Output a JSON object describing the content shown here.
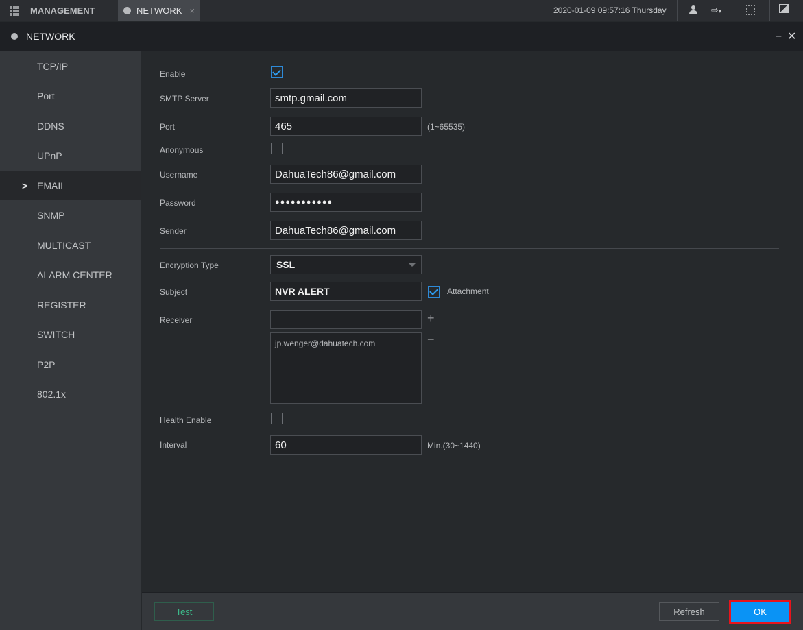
{
  "topbar": {
    "tabs": [
      {
        "label": "MANAGEMENT",
        "icon": "grid-icon"
      },
      {
        "label": "NETWORK",
        "icon": "globe-icon",
        "close": "×"
      }
    ],
    "datetime": "2020-01-09 09:57:16 Thursday"
  },
  "window": {
    "title": "NETWORK",
    "minimize": "–",
    "close": "✕"
  },
  "sidebar": {
    "items": [
      {
        "label": "TCP/IP"
      },
      {
        "label": "Port"
      },
      {
        "label": "DDNS"
      },
      {
        "label": "UPnP"
      },
      {
        "label": "EMAIL",
        "selected": true
      },
      {
        "label": "SNMP"
      },
      {
        "label": "MULTICAST"
      },
      {
        "label": "ALARM CENTER"
      },
      {
        "label": "REGISTER"
      },
      {
        "label": "SWITCH"
      },
      {
        "label": "P2P"
      },
      {
        "label": "802.1x"
      }
    ],
    "selected_marker": ">"
  },
  "form": {
    "enable": {
      "label": "Enable",
      "checked": true
    },
    "smtp_server": {
      "label": "SMTP Server",
      "value": "smtp.gmail.com"
    },
    "port": {
      "label": "Port",
      "value": "465",
      "hint": "(1~65535)"
    },
    "anonymous": {
      "label": "Anonymous",
      "checked": false
    },
    "username": {
      "label": "Username",
      "value": "DahuaTech86@gmail.com"
    },
    "password": {
      "label": "Password",
      "value": "●●●●●●●●●●●"
    },
    "sender": {
      "label": "Sender",
      "value": "DahuaTech86@gmail.com"
    },
    "encryption": {
      "label": "Encryption Type",
      "value": "SSL"
    },
    "subject": {
      "label": "Subject",
      "value": "NVR ALERT"
    },
    "attachment": {
      "label": "Attachment",
      "checked": true
    },
    "receiver": {
      "label": "Receiver",
      "value": "",
      "add": "+",
      "remove": "−",
      "list": [
        "jp.wenger@dahuatech.com"
      ]
    },
    "health_enable": {
      "label": "Health Enable",
      "checked": false
    },
    "interval": {
      "label": "Interval",
      "value": "60",
      "hint": "Min.(30~1440)"
    }
  },
  "footer": {
    "test": "Test",
    "refresh": "Refresh",
    "ok": "OK"
  },
  "colors": {
    "accent": "#0a93f5",
    "highlight": "#e8141c",
    "test_text": "#3cb98a"
  }
}
